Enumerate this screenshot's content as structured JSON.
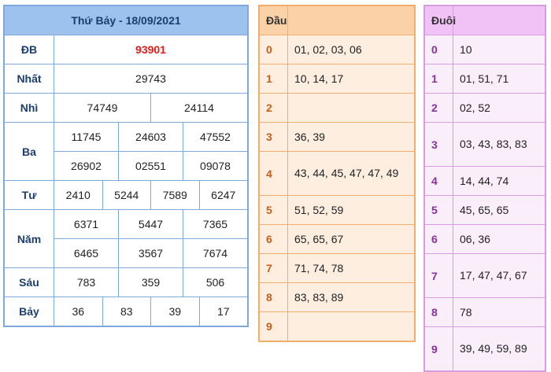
{
  "results": {
    "title": "Thứ Bảy - 18/09/2021",
    "rows": [
      {
        "label": "ĐB",
        "lines": [
          [
            "93901"
          ]
        ],
        "special": true
      },
      {
        "label": "Nhất",
        "lines": [
          [
            "29743"
          ]
        ]
      },
      {
        "label": "Nhì",
        "lines": [
          [
            "74749",
            "24114"
          ]
        ]
      },
      {
        "label": "Ba",
        "lines": [
          [
            "11745",
            "24603",
            "47552"
          ],
          [
            "26902",
            "02551",
            "09078"
          ]
        ]
      },
      {
        "label": "Tư",
        "lines": [
          [
            "2410",
            "5244",
            "7589",
            "6247"
          ]
        ]
      },
      {
        "label": "Năm",
        "lines": [
          [
            "6371",
            "5447",
            "7365"
          ],
          [
            "6465",
            "3567",
            "7674"
          ]
        ]
      },
      {
        "label": "Sáu",
        "lines": [
          [
            "783",
            "359",
            "506"
          ]
        ]
      },
      {
        "label": "Bảy",
        "lines": [
          [
            "36",
            "83",
            "39",
            "17"
          ]
        ]
      }
    ]
  },
  "dau": {
    "header": "Đầu",
    "rows": [
      {
        "key": "0",
        "value": "01, 02, 03, 06"
      },
      {
        "key": "1",
        "value": "10, 14, 17"
      },
      {
        "key": "2",
        "value": ""
      },
      {
        "key": "3",
        "value": "36, 39"
      },
      {
        "key": "4",
        "value": "43, 44, 45, 47, 47, 49"
      },
      {
        "key": "5",
        "value": "51, 52, 59"
      },
      {
        "key": "6",
        "value": "65, 65, 67"
      },
      {
        "key": "7",
        "value": "71, 74, 78"
      },
      {
        "key": "8",
        "value": "83, 83, 89"
      },
      {
        "key": "9",
        "value": ""
      }
    ]
  },
  "duoi": {
    "header": "Đuôi",
    "rows": [
      {
        "key": "0",
        "value": "10"
      },
      {
        "key": "1",
        "value": "01, 51, 71"
      },
      {
        "key": "2",
        "value": "02, 52"
      },
      {
        "key": "3",
        "value": "03, 43, 83, 83"
      },
      {
        "key": "4",
        "value": "14, 44, 74"
      },
      {
        "key": "5",
        "value": "45, 65, 65"
      },
      {
        "key": "6",
        "value": "06, 36"
      },
      {
        "key": "7",
        "value": "17, 47, 47, 67"
      },
      {
        "key": "8",
        "value": "78"
      },
      {
        "key": "9",
        "value": "39, 49, 59, 89"
      }
    ]
  }
}
